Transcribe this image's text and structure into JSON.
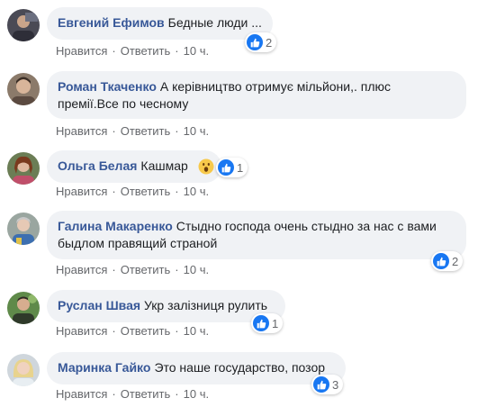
{
  "colors": {
    "bubble_bg": "#f0f2f5",
    "author": "#385898",
    "meta": "#65676b",
    "like_blue": "#1877f2"
  },
  "comments": [
    {
      "author": "Евгений Ефимов",
      "text": "Бедные люди ...",
      "text_line2": "",
      "like": "Нравится",
      "reply": "Ответить",
      "time": "10 ч.",
      "reactions": {
        "icon": "like-icon",
        "count": "2"
      }
    },
    {
      "author": "Роман Ткаченко",
      "text": "А керівництво отримує мільйони,. плюс",
      "text_line2": "премії.Все по чесному",
      "like": "Нравится",
      "reply": "Ответить",
      "time": "10 ч.",
      "reactions": null
    },
    {
      "author": "Ольга Белая",
      "text": "Кашмар",
      "text_line2": "",
      "emoji": "wow-emoji",
      "like": "Нравится",
      "reply": "Ответить",
      "time": "10 ч.",
      "reactions": {
        "icon": "like-icon",
        "count": "1"
      }
    },
    {
      "author": "Галина Макаренко",
      "text": "Стыдно господа очень стыдно за нас с вами",
      "text_line2": "быдлом правящий страной",
      "like": "Нравится",
      "reply": "Ответить",
      "time": "10 ч.",
      "reactions": {
        "icon": "like-icon",
        "count": "2"
      }
    },
    {
      "author": "Руслан Швая",
      "text": "Укр залізниця рулить",
      "text_line2": "",
      "like": "Нравится",
      "reply": "Ответить",
      "time": "10 ч.",
      "reactions": {
        "icon": "like-icon",
        "count": "1"
      }
    },
    {
      "author": "Маринка Гайко",
      "text": "Это наше государство, позор",
      "text_line2": "",
      "like": "Нравится",
      "reply": "Ответить",
      "time": "10 ч.",
      "reactions": {
        "icon": "like-icon",
        "count": "3"
      }
    }
  ]
}
